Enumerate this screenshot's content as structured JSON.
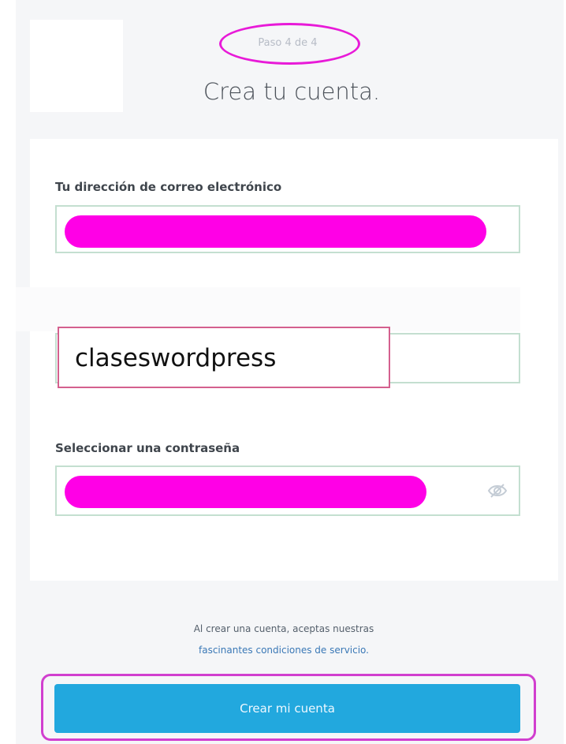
{
  "header": {
    "step": "Paso 4 de 4",
    "title": "Crea tu cuenta."
  },
  "form": {
    "email_label": "Tu dirección de correo electrónico",
    "username_value": "claseswordpress",
    "password_label": "Seleccionar una contraseña",
    "password_toggle_icon": "eye-slash-icon"
  },
  "terms": {
    "text": "Al crear una cuenta, aceptas nuestras",
    "link": "fascinantes condiciones de servicio."
  },
  "submit": {
    "label": "Crear mi cuenta"
  },
  "colors": {
    "highlight": "#e81ad8",
    "redaction": "#ff00e6",
    "button": "#22a8de",
    "link": "#3a78b6"
  }
}
